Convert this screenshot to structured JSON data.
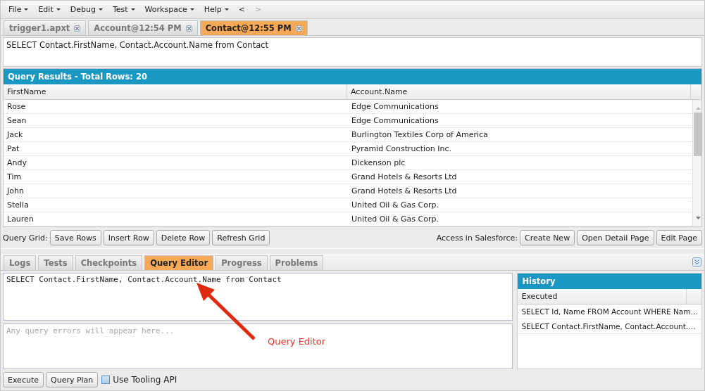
{
  "menu": [
    {
      "label": "File",
      "has_caret": true
    },
    {
      "label": "Edit",
      "has_caret": true
    },
    {
      "label": "Debug",
      "has_caret": true
    },
    {
      "label": "Test",
      "has_caret": true
    },
    {
      "label": "Workspace",
      "has_caret": true
    },
    {
      "label": "Help",
      "has_caret": true
    },
    {
      "label": "<",
      "has_caret": false,
      "disabled": false
    },
    {
      "label": ">",
      "has_caret": false,
      "disabled": true
    }
  ],
  "editor_tabs": [
    {
      "label": "trigger1.apxt",
      "selected": false
    },
    {
      "label": "Account@12:54 PM",
      "selected": false
    },
    {
      "label": "Contact@12:55 PM",
      "selected": true
    }
  ],
  "query_text": "SELECT Contact.FirstName, Contact.Account.Name from Contact",
  "results": {
    "title": "Query Results - Total Rows: 20",
    "columns": [
      "FirstName",
      "Account.Name"
    ],
    "rows": [
      [
        "Rose",
        "Edge Communications"
      ],
      [
        "Sean",
        "Edge Communications"
      ],
      [
        "Jack",
        "Burlington Textiles Corp of America"
      ],
      [
        "Pat",
        "Pyramid Construction Inc."
      ],
      [
        "Andy",
        "Dickenson plc"
      ],
      [
        "Tim",
        "Grand Hotels & Resorts Ltd"
      ],
      [
        "John",
        "Grand Hotels & Resorts Ltd"
      ],
      [
        "Stella",
        "United Oil & Gas Corp."
      ],
      [
        "Lauren",
        "United Oil & Gas Corp."
      ]
    ]
  },
  "grid_toolbar": {
    "label": "Query Grid:",
    "buttons": [
      "Save Rows",
      "Insert Row",
      "Delete Row",
      "Refresh Grid"
    ],
    "right_label": "Access in Salesforce:",
    "right_buttons": [
      "Create New",
      "Open Detail Page",
      "Edit Page"
    ]
  },
  "panel_tabs": [
    {
      "label": "Logs",
      "selected": false
    },
    {
      "label": "Tests",
      "selected": false
    },
    {
      "label": "Checkpoints",
      "selected": false
    },
    {
      "label": "Query Editor",
      "selected": true
    },
    {
      "label": "Progress",
      "selected": false
    },
    {
      "label": "Problems",
      "selected": false
    }
  ],
  "query_editor": {
    "value": "SELECT Contact.FirstName, Contact.Account.Name from Contact",
    "errors_placeholder": "Any query errors will appear here..."
  },
  "history": {
    "title": "History",
    "column": "Executed",
    "items": [
      "SELECT Id, Name FROM Account WHERE Nam…",
      "SELECT Contact.FirstName, Contact.Account.…"
    ]
  },
  "bottom_bar": {
    "buttons": [
      "Execute",
      "Query Plan"
    ],
    "checkbox": {
      "label": "Use Tooling API",
      "checked": false
    }
  },
  "annotation": {
    "label": "Query Editor"
  }
}
